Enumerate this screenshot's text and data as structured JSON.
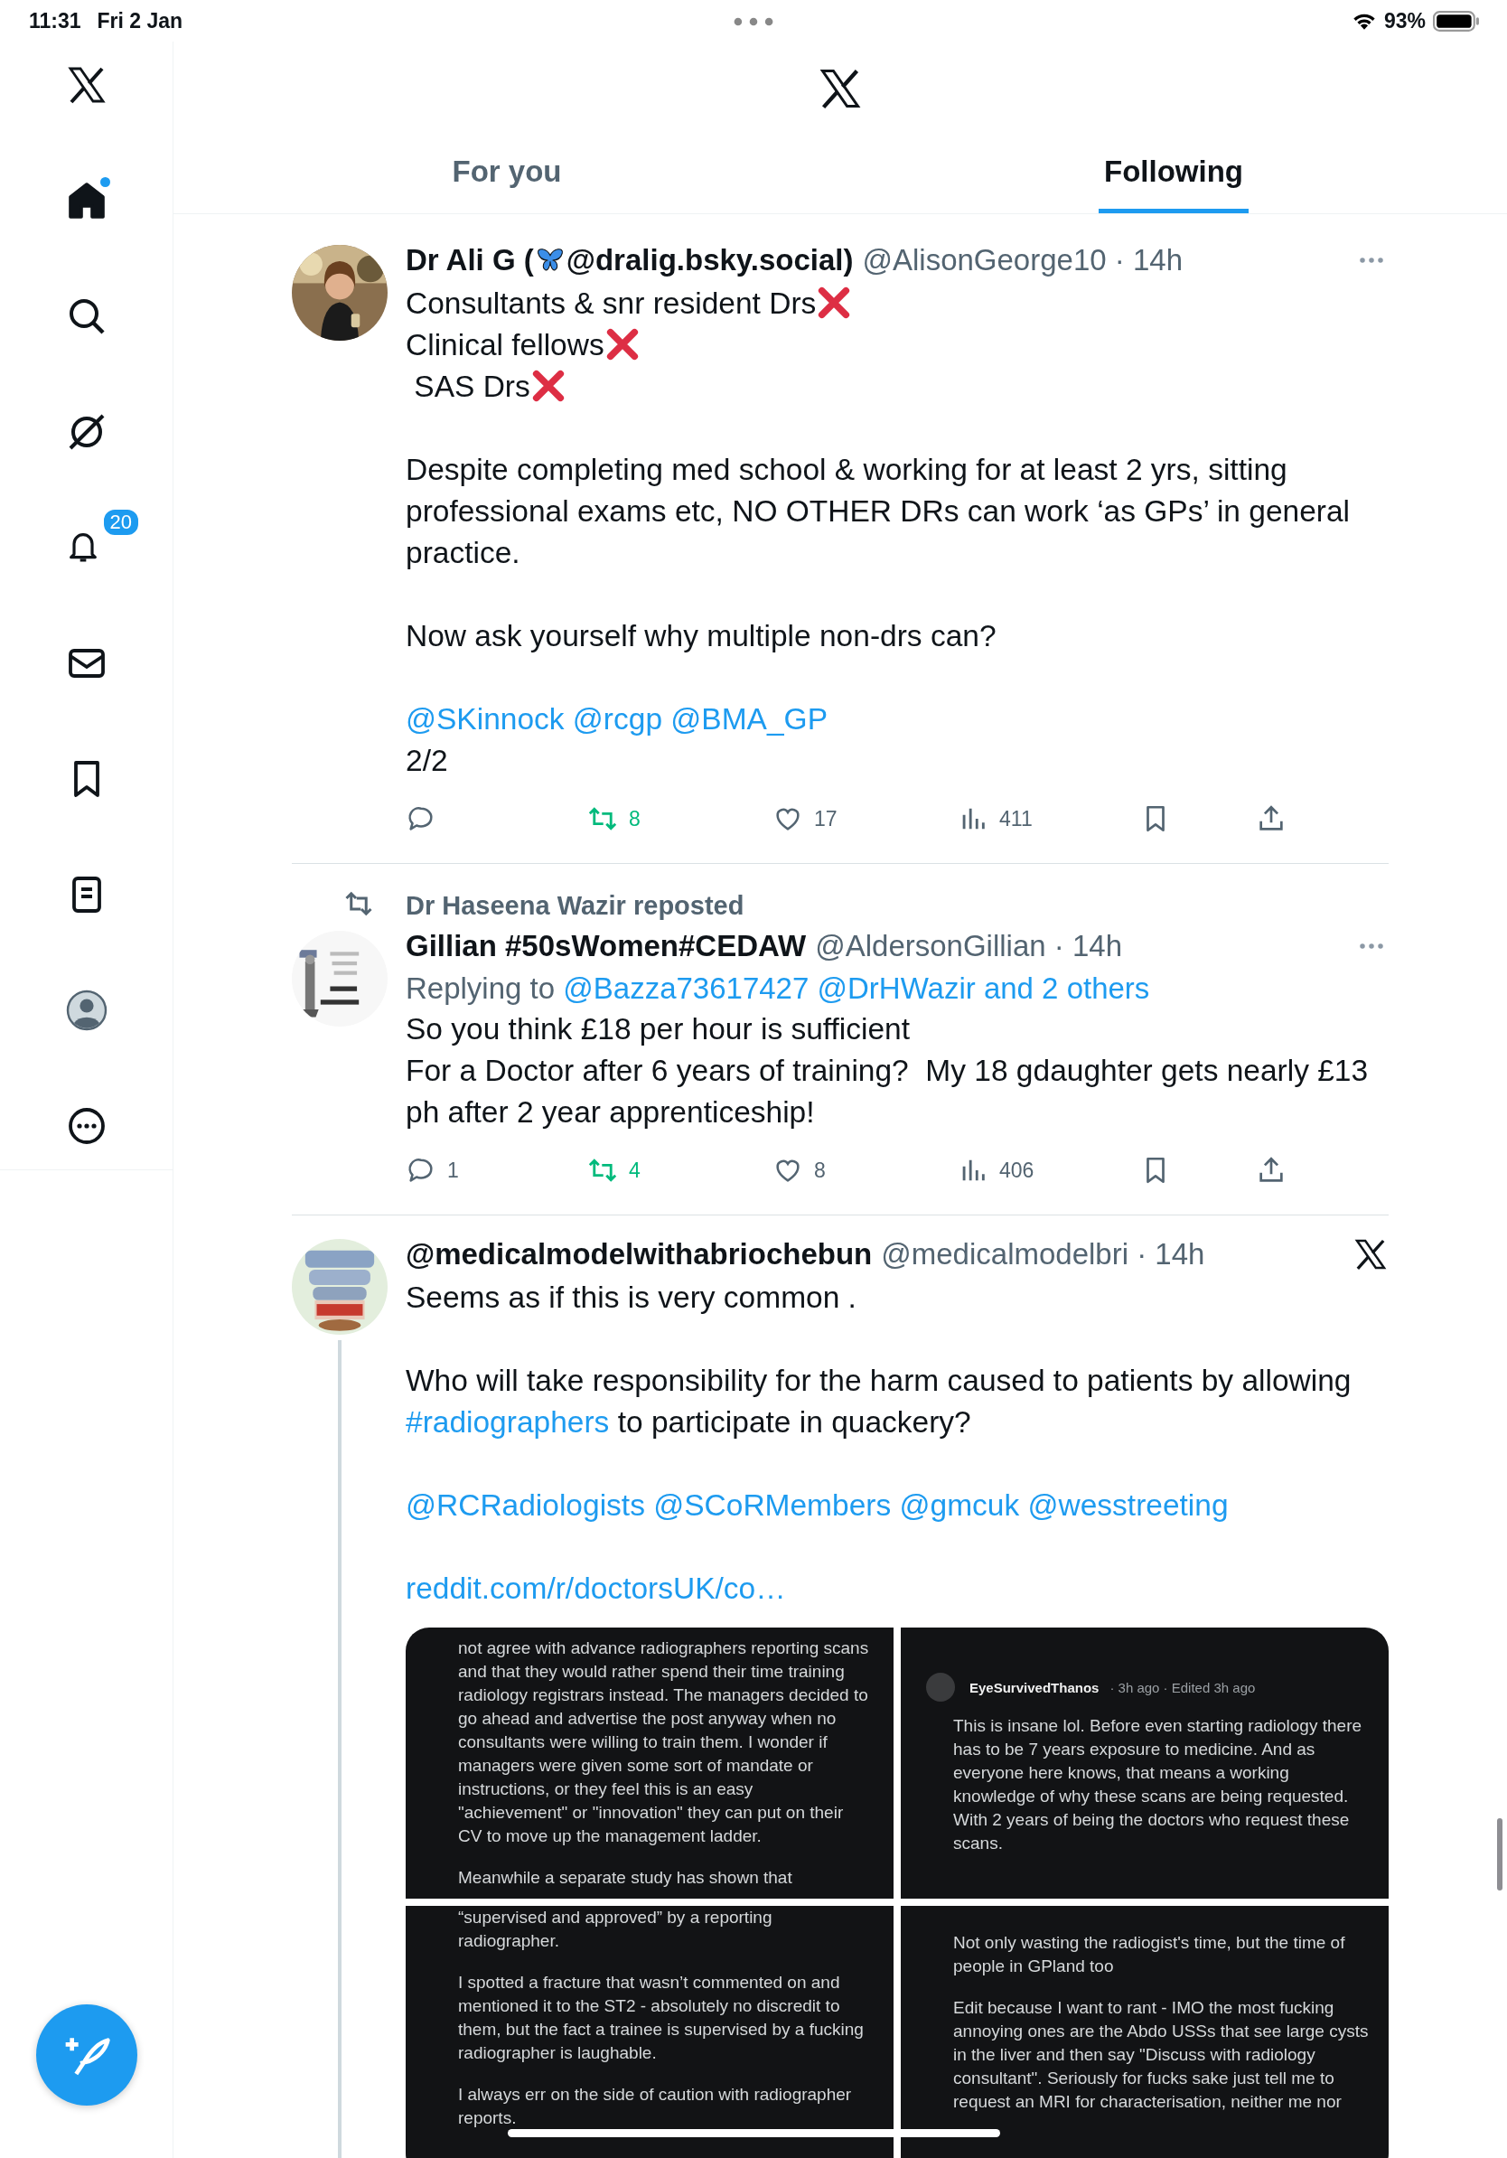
{
  "status_bar": {
    "time": "11:31",
    "date": "Fri 2 Jan",
    "battery": "93%"
  },
  "sidebar": {
    "items": [
      {
        "kind": "logo",
        "selected": false
      },
      {
        "kind": "home",
        "selected": true,
        "dot": true
      },
      {
        "kind": "search",
        "selected": false
      },
      {
        "kind": "grok",
        "selected": false
      },
      {
        "kind": "notifications",
        "selected": false,
        "badge": "20"
      },
      {
        "kind": "messages",
        "selected": false
      },
      {
        "kind": "bookmarks",
        "selected": false
      },
      {
        "kind": "lists",
        "selected": false
      },
      {
        "kind": "profile",
        "selected": false
      },
      {
        "kind": "more",
        "selected": false
      }
    ]
  },
  "tabs": [
    {
      "label": "For you",
      "selected": false
    },
    {
      "label": "Following",
      "selected": true
    }
  ],
  "tweets": [
    {
      "name": [
        {
          "kind": "text",
          "text": "Dr Ali G ("
        },
        {
          "kind": "butterfly"
        },
        {
          "kind": "text",
          "text": " @dralig.bsky.social)"
        }
      ],
      "handle_time": "@AlisonGeorge10 · 14h",
      "menu": true,
      "paragraphs": [
        [
          [
            {
              "kind": "text",
              "text": "Consultants & snr resident Drs"
            },
            {
              "kind": "cross"
            }
          ],
          [
            {
              "kind": "text",
              "text": "Clinical fellows"
            },
            {
              "kind": "cross"
            }
          ],
          [
            {
              "kind": "text",
              "text": " SAS Drs"
            },
            {
              "kind": "cross"
            }
          ]
        ],
        [
          [
            {
              "kind": "text",
              "text": "Despite completing med school & working for at least 2 yrs, sitting"
            }
          ],
          [
            {
              "kind": "text",
              "text": "professional exams etc, NO OTHER DRs can work ‘as GPs’ in general"
            }
          ],
          [
            {
              "kind": "text",
              "text": "practice."
            }
          ]
        ],
        [
          [
            {
              "kind": "text",
              "text": "Now ask yourself why multiple non-drs can?"
            }
          ]
        ],
        [
          [
            {
              "kind": "link",
              "text": "@SKinnock"
            },
            {
              "kind": "link",
              "text": "@rcgp"
            },
            {
              "kind": "link",
              "text": "@BMA_GP"
            }
          ],
          [
            {
              "kind": "text",
              "text": "2/2"
            }
          ]
        ]
      ],
      "actions": {
        "reposts": "8",
        "reposted": true,
        "likes": "17",
        "views": "411"
      }
    },
    {
      "repost_by": "Dr Haseena Wazir reposted",
      "name": [
        {
          "kind": "text",
          "text": "Gillian #50sWomen#CEDAW"
        }
      ],
      "handle_time": "@AldersonGillian · 14h",
      "menu": true,
      "replying": {
        "label": "Replying to ",
        "targets": "@Bazza73617427 @DrHWazir and 2 others"
      },
      "paragraphs": [
        [
          [
            {
              "kind": "text",
              "text": "So you think £18 per hour is sufficient"
            }
          ],
          [
            {
              "kind": "text",
              "text": "For a Doctor after 6 years of training?  My 18 gdaughter gets nearly £13"
            }
          ],
          [
            {
              "kind": "text",
              "text": "ph after 2 year apprenticeship!"
            }
          ]
        ]
      ],
      "actions": {
        "replies": "1",
        "reposts": "4",
        "reposted": true,
        "likes": "8",
        "views": "406"
      }
    },
    {
      "name": [
        {
          "kind": "text",
          "text": "@medicalmodelwithabriochebun"
        }
      ],
      "handle_time": "@medicalmodelbri · 14h",
      "x_badge": true,
      "thread": true,
      "paragraphs": [
        [
          [
            {
              "kind": "text",
              "text": "Seems as if this is very common ."
            }
          ]
        ],
        [
          [
            {
              "kind": "text",
              "text": "Who will take responsibility for the harm caused to patients by allowing"
            }
          ],
          [
            {
              "kind": "link",
              "text": "#radiographers"
            },
            {
              "kind": "text",
              "text": " to participate in quackery?"
            }
          ]
        ],
        [
          [
            {
              "kind": "link",
              "text": "@RCRadiologists"
            },
            {
              "kind": "link",
              "text": "@SCoRMembers"
            },
            {
              "kind": "link",
              "text": "@gmcuk"
            },
            {
              "kind": "link",
              "text": "@wesstreeting"
            }
          ]
        ],
        [
          [
            {
              "kind": "link",
              "text": "reddit.com/r/doctorsUK/co…"
            }
          ]
        ]
      ],
      "media": [
        {
          "kind": "post",
          "paragraphs": [
            [
              "not agree with advance radiographers reporting scans",
              "and that they would rather spend their time training",
              "radiology registrars instead. The managers decided to",
              "go ahead and advertise the post anyway when no",
              "consultants were willing to train them. I wonder if",
              "managers were given some sort of mandate or",
              "instructions, or they feel this is an easy",
              "\"achievement\" or \"innovation\" they can put on their",
              "CV to move up the management ladder."
            ],
            [
              "Meanwhile a separate study has shown that"
            ]
          ]
        },
        {
          "kind": "comment",
          "author": "EyeSurvivedThanos",
          "meta": "· 3h ago · Edited 3h ago",
          "paragraphs": [
            [
              "This is insane lol. Before even starting radiology there",
              "has to be 7 years exposure to medicine. And as",
              "everyone here knows, that means a working",
              "knowledge of why these scans are being requested.",
              "With 2 years of being the doctors who request these",
              "scans."
            ]
          ]
        },
        {
          "kind": "post",
          "paragraphs": [
            [
              "“supervised and approved” by a reporting",
              "radiographer."
            ],
            [
              "I spotted a fracture that wasn’t commented on and",
              "mentioned it to the ST2 - absolutely no discredit to",
              "them, but the fact a trainee is supervised by a fucking",
              "radiographer is laughable."
            ],
            [
              "I always err on the side of caution with radiographer",
              "reports."
            ]
          ]
        },
        {
          "kind": "post",
          "paragraphs": [
            [
              "Not only wasting the radiogist's time, but the time of",
              "people in GPland too"
            ],
            [
              "Edit because I want to rant - IMO the most fucking",
              "annoying ones are the Abdo USSs that see large cysts",
              "in the liver and then say \"Discuss with radiology",
              "consultant\". Seriously for fucks sake just tell me to",
              "request an MRI for characterisation, neither me nor"
            ]
          ]
        }
      ]
    }
  ]
}
